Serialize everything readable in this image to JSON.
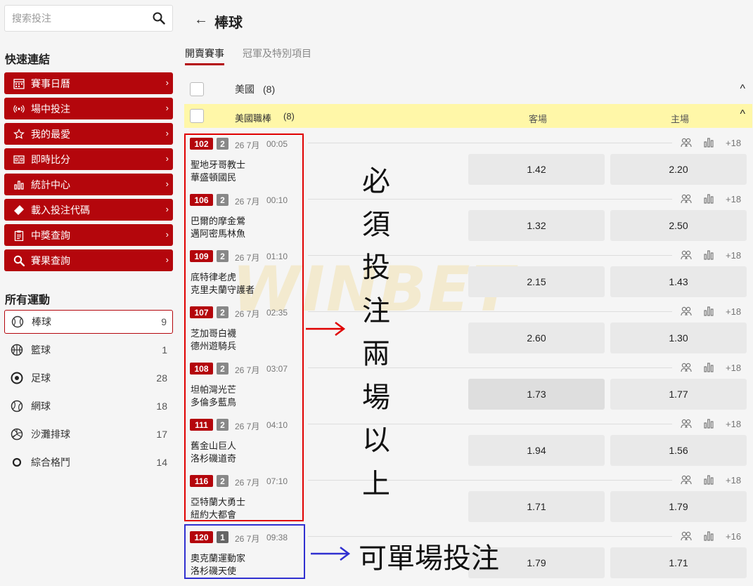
{
  "sidebar": {
    "search_placeholder": "搜索投注",
    "quick_links_title": "快速連結",
    "quick_links": [
      {
        "label": "賽事日曆",
        "icon": "calendar-icon"
      },
      {
        "label": "場中投注",
        "icon": "live-signal-icon"
      },
      {
        "label": "我的最愛",
        "icon": "star-icon"
      },
      {
        "label": "即時比分",
        "icon": "scoreboard-icon"
      },
      {
        "label": "統計中心",
        "icon": "bar-chart-icon"
      },
      {
        "label": "載入投注代碼",
        "icon": "ticket-icon"
      },
      {
        "label": "中獎查詢",
        "icon": "clipboard-icon"
      },
      {
        "label": "賽果查詢",
        "icon": "search-icon"
      }
    ],
    "all_sports_title": "所有運動",
    "sports": [
      {
        "label": "棒球",
        "count": "9",
        "icon": "baseball-icon"
      },
      {
        "label": "籃球",
        "count": "1",
        "icon": "basketball-icon"
      },
      {
        "label": "足球",
        "count": "28",
        "icon": "soccer-icon"
      },
      {
        "label": "網球",
        "count": "18",
        "icon": "tennis-icon"
      },
      {
        "label": "沙灘排球",
        "count": "17",
        "icon": "volleyball-icon"
      },
      {
        "label": "綜合格鬥",
        "count": "14",
        "icon": "mma-icon"
      }
    ]
  },
  "header": {
    "title": "棒球",
    "back_icon": "arrow-left-icon"
  },
  "tabs": [
    {
      "label": "開賣賽事",
      "active": true
    },
    {
      "label": "冠軍及特別項目",
      "active": false
    }
  ],
  "region": {
    "label": "美國",
    "count": "(8)"
  },
  "league": {
    "label": "美國職棒",
    "count": "(8)",
    "away_header": "客場",
    "home_header": "主場"
  },
  "matches": [
    {
      "num": "102",
      "legs": "2",
      "date": "26 7月",
      "time": "00:05",
      "team1": "聖地牙哥教士",
      "team2": "華盛頓國民",
      "away": "1.42",
      "home": "2.20",
      "more": "+18"
    },
    {
      "num": "106",
      "legs": "2",
      "date": "26 7月",
      "time": "00:10",
      "team1": "巴爾的摩金鶯",
      "team2": "邁阿密馬林魚",
      "away": "1.32",
      "home": "2.50",
      "more": "+18"
    },
    {
      "num": "109",
      "legs": "2",
      "date": "26 7月",
      "time": "01:10",
      "team1": "底特律老虎",
      "team2": "克里夫蘭守護者",
      "away": "2.15",
      "home": "1.43",
      "more": "+18"
    },
    {
      "num": "107",
      "legs": "2",
      "date": "26 7月",
      "time": "02:35",
      "team1": "芝加哥白襪",
      "team2": "德州遊騎兵",
      "away": "2.60",
      "home": "1.30",
      "more": "+18"
    },
    {
      "num": "108",
      "legs": "2",
      "date": "26 7月",
      "time": "03:07",
      "team1": "坦帕灣光芒",
      "team2": "多倫多藍鳥",
      "away": "1.73",
      "home": "1.77",
      "more": "+18"
    },
    {
      "num": "111",
      "legs": "2",
      "date": "26 7月",
      "time": "04:10",
      "team1": "舊金山巨人",
      "team2": "洛杉磯道奇",
      "away": "1.94",
      "home": "1.56",
      "more": "+18"
    },
    {
      "num": "116",
      "legs": "2",
      "date": "26 7月",
      "time": "07:10",
      "team1": "亞特蘭大勇士",
      "team2": "紐約大都會",
      "away": "1.71",
      "home": "1.79",
      "more": "+18"
    },
    {
      "num": "120",
      "legs": "1",
      "date": "26 7月",
      "time": "09:38",
      "team1": "奧克蘭運動家",
      "team2": "洛杉磯天使",
      "away": "1.79",
      "home": "1.71",
      "more": "+16"
    }
  ],
  "annotations": {
    "multi_note": [
      "必",
      "須",
      "投",
      "注",
      "兩",
      "場",
      "以",
      "上"
    ],
    "single_note": "可單場投注"
  },
  "watermark": "WINBET",
  "colors": {
    "brand_red": "#b4060c",
    "league_bg": "#fff7a8",
    "odds_bg": "#e9e9e9",
    "annotation_red": "#e00000",
    "annotation_blue": "#3030d0"
  }
}
